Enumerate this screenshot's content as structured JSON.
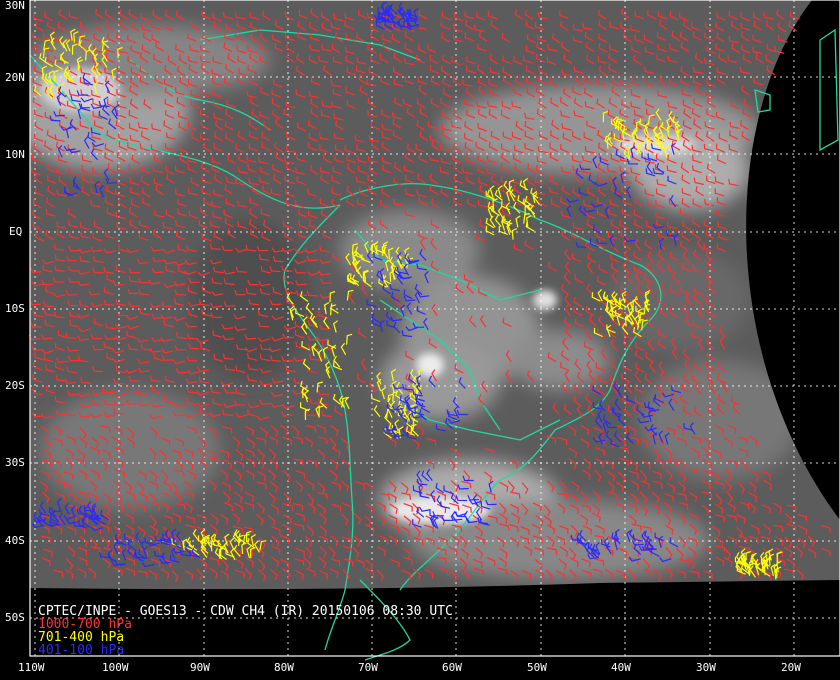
{
  "product": {
    "title": "CPTEC/INPE - GOES13 - CDW CH4 (IR) 20150106 08:30 UTC"
  },
  "legend": [
    {
      "label": "1000-700 hPa",
      "color": "#ff3030"
    },
    {
      "label": "701-400 hPa",
      "color": "#ffff00"
    },
    {
      "label": "401-100 hPa",
      "color": "#2a2aff"
    }
  ],
  "colors": {
    "background": "#000000",
    "coastline": "#20d9a0",
    "grid": "#ffffff",
    "label": "#ffffff"
  },
  "axes": {
    "latitude_labels": [
      "30N",
      "20N",
      "10N",
      "EQ",
      "10S",
      "20S",
      "30S",
      "40S",
      "50S"
    ],
    "longitude_labels": [
      "110W",
      "100W",
      "90W",
      "80W",
      "70W",
      "60W",
      "50W",
      "40W",
      "30W",
      "20W"
    ]
  }
}
